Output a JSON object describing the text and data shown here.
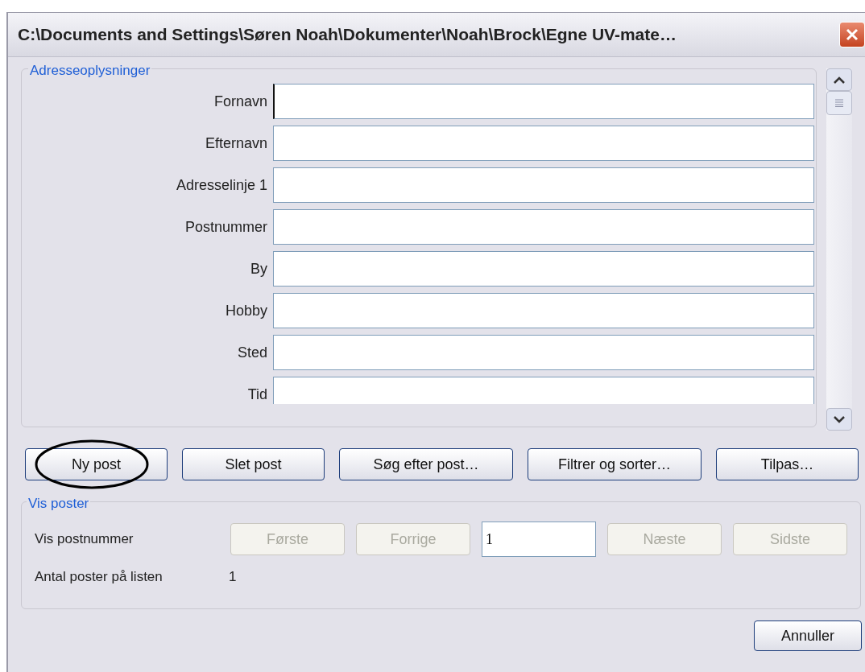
{
  "window": {
    "title": "C:\\Documents and Settings\\Søren Noah\\Dokumenter\\Noah\\Brock\\Egne UV-mate…"
  },
  "address_group": {
    "title": "Adresseoplysninger",
    "fields": [
      {
        "label": "Fornavn",
        "focused": true
      },
      {
        "label": "Efternavn",
        "focused": false
      },
      {
        "label": "Adresselinje 1",
        "focused": false
      },
      {
        "label": "Postnummer",
        "focused": false
      },
      {
        "label": "By",
        "focused": false
      },
      {
        "label": "Hobby",
        "focused": false
      },
      {
        "label": "Sted",
        "focused": false
      },
      {
        "label": "Tid",
        "focused": false
      }
    ]
  },
  "record_buttons": [
    {
      "label": "Ny post",
      "circled": true
    },
    {
      "label": "Slet post",
      "circled": false
    },
    {
      "label": "Søg efter post…",
      "circled": false
    },
    {
      "label": "Filtrer og sorter…",
      "circled": false
    },
    {
      "label": "Tilpas…",
      "circled": false
    }
  ],
  "view_group": {
    "title": "Vis poster",
    "record_label": "Vis postnummer",
    "nav_buttons": [
      {
        "label": "Første",
        "disabled": true
      },
      {
        "label": "Forrige",
        "disabled": true
      },
      {
        "kind": "field",
        "value": "1"
      },
      {
        "label": "Næste",
        "disabled": true
      },
      {
        "label": "Sidste",
        "disabled": true
      }
    ],
    "count_label": "Antal poster på listen",
    "count_value": "1"
  },
  "cancel_button": "Annuller"
}
